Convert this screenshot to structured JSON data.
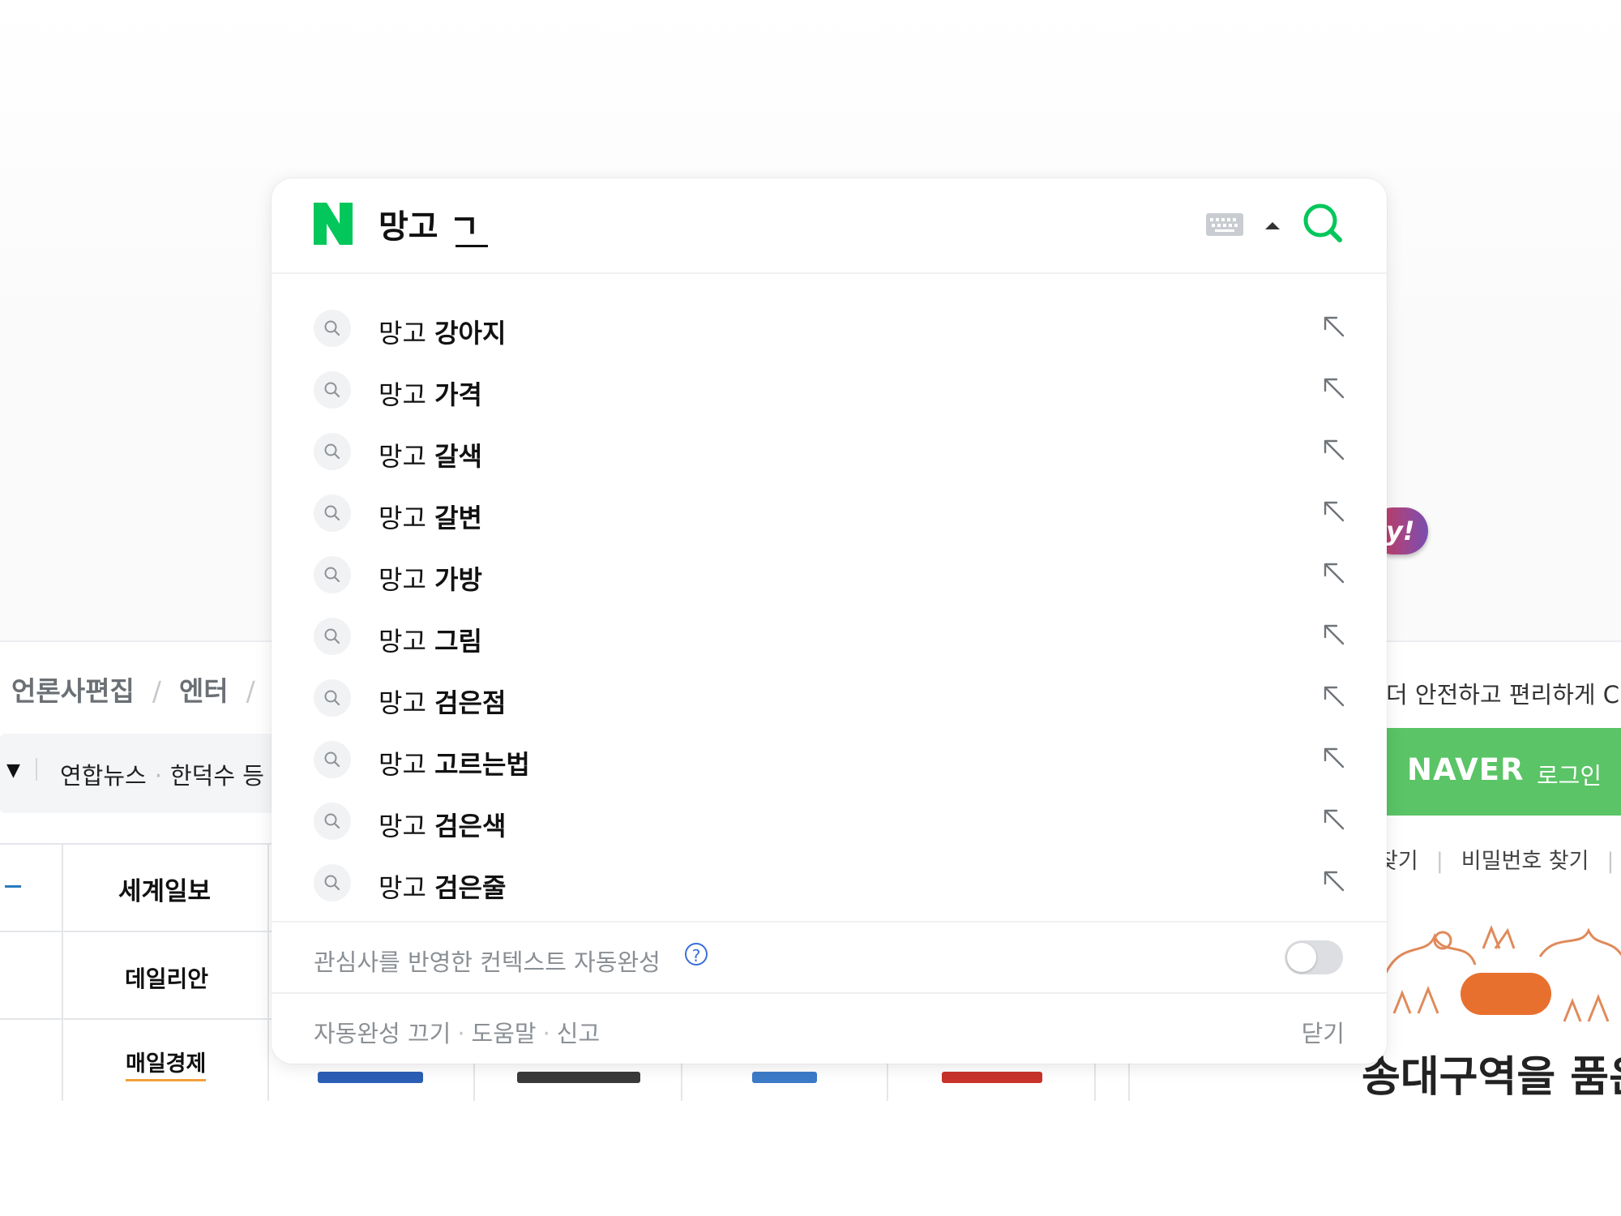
{
  "search": {
    "query": "망고 ㄱ",
    "logo_letter": "N"
  },
  "suggestions": [
    {
      "prefix": "망고 ",
      "completion": "강아지"
    },
    {
      "prefix": "망고 ",
      "completion": "가격"
    },
    {
      "prefix": "망고 ",
      "completion": "갈색"
    },
    {
      "prefix": "망고 ",
      "completion": "갈변"
    },
    {
      "prefix": "망고 ",
      "completion": "가방"
    },
    {
      "prefix": "망고 ",
      "completion": "그림"
    },
    {
      "prefix": "망고 ",
      "completion": "검은점"
    },
    {
      "prefix": "망고 ",
      "completion": "고르는법"
    },
    {
      "prefix": "망고 ",
      "completion": "검은색"
    },
    {
      "prefix": "망고 ",
      "completion": "검은줄"
    }
  ],
  "context_autocomplete": {
    "label": "관심사를 반영한 컨텍스트 자동완성",
    "help": "?",
    "enabled": false
  },
  "footer": {
    "autocomplete_off": "자동완성 끄기",
    "help": "도움말",
    "report": "신고",
    "close": "닫기"
  },
  "background": {
    "news_tabs": [
      "언론사편집",
      "엔터"
    ],
    "headline": {
      "source": "연합뉴스",
      "text": "한덕수 등"
    },
    "press": [
      "세계일보",
      "데일리안",
      "매일경제"
    ],
    "login_caption": "더 안전하고 편리하게 C",
    "login_brand": "NAVER",
    "login_label": "로그인",
    "find_links": [
      "찾기",
      "비밀번호 찾기"
    ],
    "banner_text": "송대구역을 품은",
    "ad_text": "y!"
  },
  "colors": {
    "naver_green": "#03c75a",
    "login_green": "#5ac466",
    "help_blue": "#3a6fd8",
    "banner_orange": "#e8702e"
  }
}
